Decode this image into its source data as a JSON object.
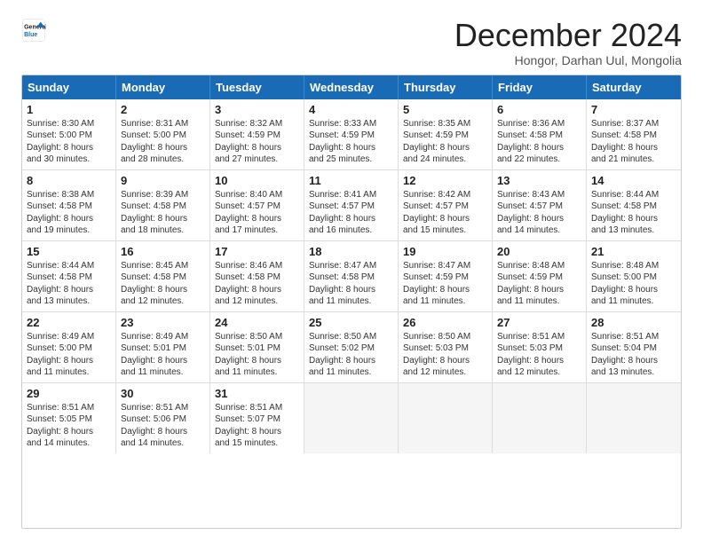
{
  "logo": {
    "line1": "General",
    "line2": "Blue"
  },
  "title": "December 2024",
  "location": "Hongor, Darhan Uul, Mongolia",
  "header_days": [
    "Sunday",
    "Monday",
    "Tuesday",
    "Wednesday",
    "Thursday",
    "Friday",
    "Saturday"
  ],
  "weeks": [
    [
      {
        "day": "1",
        "lines": [
          "Sunrise: 8:30 AM",
          "Sunset: 5:00 PM",
          "Daylight: 8 hours",
          "and 30 minutes."
        ]
      },
      {
        "day": "2",
        "lines": [
          "Sunrise: 8:31 AM",
          "Sunset: 5:00 PM",
          "Daylight: 8 hours",
          "and 28 minutes."
        ]
      },
      {
        "day": "3",
        "lines": [
          "Sunrise: 8:32 AM",
          "Sunset: 4:59 PM",
          "Daylight: 8 hours",
          "and 27 minutes."
        ]
      },
      {
        "day": "4",
        "lines": [
          "Sunrise: 8:33 AM",
          "Sunset: 4:59 PM",
          "Daylight: 8 hours",
          "and 25 minutes."
        ]
      },
      {
        "day": "5",
        "lines": [
          "Sunrise: 8:35 AM",
          "Sunset: 4:59 PM",
          "Daylight: 8 hours",
          "and 24 minutes."
        ]
      },
      {
        "day": "6",
        "lines": [
          "Sunrise: 8:36 AM",
          "Sunset: 4:58 PM",
          "Daylight: 8 hours",
          "and 22 minutes."
        ]
      },
      {
        "day": "7",
        "lines": [
          "Sunrise: 8:37 AM",
          "Sunset: 4:58 PM",
          "Daylight: 8 hours",
          "and 21 minutes."
        ]
      }
    ],
    [
      {
        "day": "8",
        "lines": [
          "Sunrise: 8:38 AM",
          "Sunset: 4:58 PM",
          "Daylight: 8 hours",
          "and 19 minutes."
        ]
      },
      {
        "day": "9",
        "lines": [
          "Sunrise: 8:39 AM",
          "Sunset: 4:58 PM",
          "Daylight: 8 hours",
          "and 18 minutes."
        ]
      },
      {
        "day": "10",
        "lines": [
          "Sunrise: 8:40 AM",
          "Sunset: 4:57 PM",
          "Daylight: 8 hours",
          "and 17 minutes."
        ]
      },
      {
        "day": "11",
        "lines": [
          "Sunrise: 8:41 AM",
          "Sunset: 4:57 PM",
          "Daylight: 8 hours",
          "and 16 minutes."
        ]
      },
      {
        "day": "12",
        "lines": [
          "Sunrise: 8:42 AM",
          "Sunset: 4:57 PM",
          "Daylight: 8 hours",
          "and 15 minutes."
        ]
      },
      {
        "day": "13",
        "lines": [
          "Sunrise: 8:43 AM",
          "Sunset: 4:57 PM",
          "Daylight: 8 hours",
          "and 14 minutes."
        ]
      },
      {
        "day": "14",
        "lines": [
          "Sunrise: 8:44 AM",
          "Sunset: 4:58 PM",
          "Daylight: 8 hours",
          "and 13 minutes."
        ]
      }
    ],
    [
      {
        "day": "15",
        "lines": [
          "Sunrise: 8:44 AM",
          "Sunset: 4:58 PM",
          "Daylight: 8 hours",
          "and 13 minutes."
        ]
      },
      {
        "day": "16",
        "lines": [
          "Sunrise: 8:45 AM",
          "Sunset: 4:58 PM",
          "Daylight: 8 hours",
          "and 12 minutes."
        ]
      },
      {
        "day": "17",
        "lines": [
          "Sunrise: 8:46 AM",
          "Sunset: 4:58 PM",
          "Daylight: 8 hours",
          "and 12 minutes."
        ]
      },
      {
        "day": "18",
        "lines": [
          "Sunrise: 8:47 AM",
          "Sunset: 4:58 PM",
          "Daylight: 8 hours",
          "and 11 minutes."
        ]
      },
      {
        "day": "19",
        "lines": [
          "Sunrise: 8:47 AM",
          "Sunset: 4:59 PM",
          "Daylight: 8 hours",
          "and 11 minutes."
        ]
      },
      {
        "day": "20",
        "lines": [
          "Sunrise: 8:48 AM",
          "Sunset: 4:59 PM",
          "Daylight: 8 hours",
          "and 11 minutes."
        ]
      },
      {
        "day": "21",
        "lines": [
          "Sunrise: 8:48 AM",
          "Sunset: 5:00 PM",
          "Daylight: 8 hours",
          "and 11 minutes."
        ]
      }
    ],
    [
      {
        "day": "22",
        "lines": [
          "Sunrise: 8:49 AM",
          "Sunset: 5:00 PM",
          "Daylight: 8 hours",
          "and 11 minutes."
        ]
      },
      {
        "day": "23",
        "lines": [
          "Sunrise: 8:49 AM",
          "Sunset: 5:01 PM",
          "Daylight: 8 hours",
          "and 11 minutes."
        ]
      },
      {
        "day": "24",
        "lines": [
          "Sunrise: 8:50 AM",
          "Sunset: 5:01 PM",
          "Daylight: 8 hours",
          "and 11 minutes."
        ]
      },
      {
        "day": "25",
        "lines": [
          "Sunrise: 8:50 AM",
          "Sunset: 5:02 PM",
          "Daylight: 8 hours",
          "and 11 minutes."
        ]
      },
      {
        "day": "26",
        "lines": [
          "Sunrise: 8:50 AM",
          "Sunset: 5:03 PM",
          "Daylight: 8 hours",
          "and 12 minutes."
        ]
      },
      {
        "day": "27",
        "lines": [
          "Sunrise: 8:51 AM",
          "Sunset: 5:03 PM",
          "Daylight: 8 hours",
          "and 12 minutes."
        ]
      },
      {
        "day": "28",
        "lines": [
          "Sunrise: 8:51 AM",
          "Sunset: 5:04 PM",
          "Daylight: 8 hours",
          "and 13 minutes."
        ]
      }
    ],
    [
      {
        "day": "29",
        "lines": [
          "Sunrise: 8:51 AM",
          "Sunset: 5:05 PM",
          "Daylight: 8 hours",
          "and 14 minutes."
        ]
      },
      {
        "day": "30",
        "lines": [
          "Sunrise: 8:51 AM",
          "Sunset: 5:06 PM",
          "Daylight: 8 hours",
          "and 14 minutes."
        ]
      },
      {
        "day": "31",
        "lines": [
          "Sunrise: 8:51 AM",
          "Sunset: 5:07 PM",
          "Daylight: 8 hours",
          "and 15 minutes."
        ]
      },
      {
        "day": "",
        "lines": []
      },
      {
        "day": "",
        "lines": []
      },
      {
        "day": "",
        "lines": []
      },
      {
        "day": "",
        "lines": []
      }
    ]
  ]
}
